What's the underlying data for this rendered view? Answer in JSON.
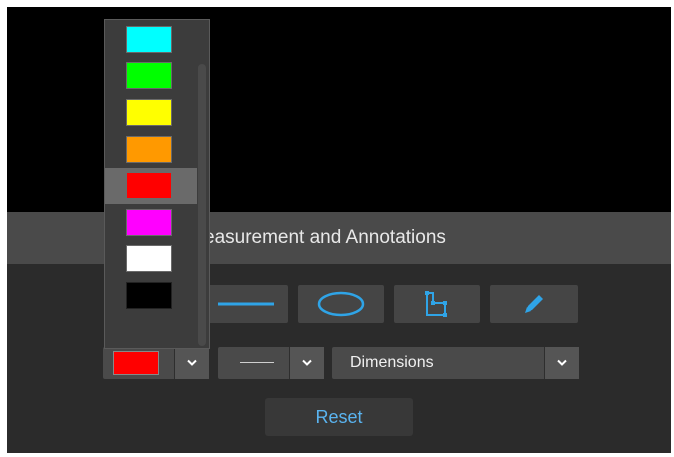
{
  "panel": {
    "title": "easurement and Annotations",
    "reset_label": "Reset"
  },
  "tools": [
    {
      "name": "line",
      "icon": "line-tool-icon"
    },
    {
      "name": "ellipse",
      "icon": "ellipse-tool-icon"
    },
    {
      "name": "polygon",
      "icon": "polygon-tool-icon"
    },
    {
      "name": "freehand",
      "icon": "pencil-tool-icon"
    }
  ],
  "controls": {
    "color": {
      "selected": "#ff0000",
      "icon": "chevron-down-icon"
    },
    "line_style": {
      "selected": "solid",
      "icon": "chevron-down-icon"
    },
    "annotation_mode": {
      "selected": "Dimensions",
      "icon": "chevron-down-icon"
    }
  },
  "color_options": [
    "#00ffff",
    "#00ff00",
    "#ffff00",
    "#ff9900",
    "#ff0000",
    "#ff00ff",
    "#ffffff",
    "#000000"
  ],
  "colors": {
    "accent": "#5ab4f0",
    "panel_bg": "#2b2b2b",
    "header_bg": "#4a4a4a"
  }
}
